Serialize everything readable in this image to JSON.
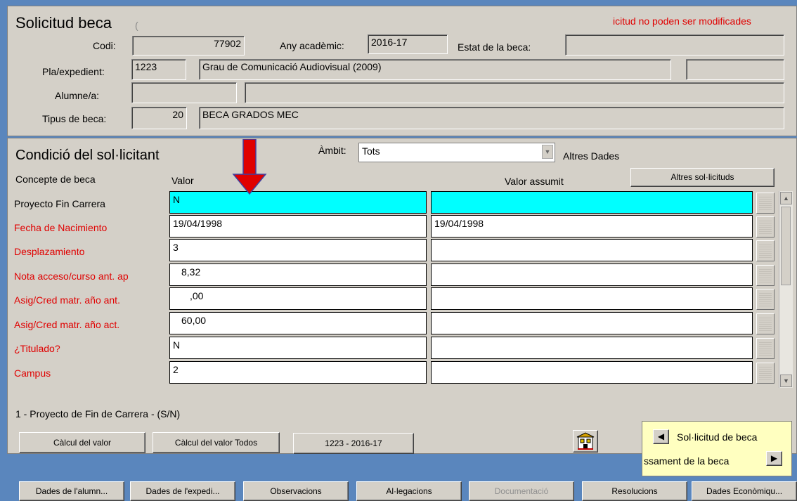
{
  "header": {
    "title": "Solicitud beca",
    "warning": "icitud no poden ser modificades",
    "codi_label": "Codi:",
    "codi_value": "77902",
    "any_label": "Any acadèmic:",
    "any_value": "2016-17",
    "estat_label": "Estat de la beca:",
    "pla_label": "Pla/expedient:",
    "pla_code": "1223",
    "pla_name": "Grau de Comunicació Audiovisual (2009)",
    "alumne_label": "Alumne/a:",
    "tipus_label": "Tipus de beca:",
    "tipus_code": "20",
    "tipus_name": "BECA GRADOS MEC"
  },
  "condicio": {
    "title": "Condició del sol·licitant",
    "ambit_label": "Àmbit:",
    "ambit_value": "Tots",
    "altres_dades": "Altres Dades",
    "col_concepte": "Concepte de beca",
    "col_valor": "Valor",
    "col_assumit": "Valor assumit",
    "altres_solicituds_button": "Altres sol·licituds",
    "rows": [
      {
        "concepte": "Proyecto Fin Carrera",
        "valor": "N",
        "assumit": ""
      },
      {
        "concepte": "Fecha de Nacimiento",
        "valor": "19/04/1998",
        "assumit": "19/04/1998"
      },
      {
        "concepte": "Desplazamiento",
        "valor": "3",
        "assumit": ""
      },
      {
        "concepte": "Nota acceso/curso ant. ap",
        "valor": "8,32",
        "assumit": ""
      },
      {
        "concepte": "Asig/Cred matr. año ant.",
        "valor": ",00",
        "assumit": ""
      },
      {
        "concepte": "Asig/Cred matr. año act.",
        "valor": "60,00",
        "assumit": ""
      },
      {
        "concepte": "¿Titulado?",
        "valor": "N",
        "assumit": ""
      },
      {
        "concepte": "Campus",
        "valor": "2",
        "assumit": ""
      }
    ],
    "hint": "1 - Proyecto de Fin de Carrera - (S/N)",
    "calc_button": "Càlcul del valor",
    "calc_all_button": "Càlcul del valor Todos",
    "plan_year_button": "1223 - 2016-17"
  },
  "nav_box": {
    "solicitud": "Sol·licitud de beca",
    "processament": "ssament de la beca"
  },
  "bottom_buttons": [
    {
      "label": "Dades de l'alumn...",
      "enabled": true
    },
    {
      "label": "Dades de l'expedi...",
      "enabled": true
    },
    {
      "label": "Observacions",
      "enabled": true
    },
    {
      "label": "Al·legacions",
      "enabled": true
    },
    {
      "label": "Documentació",
      "enabled": false
    },
    {
      "label": "Resolucions",
      "enabled": true
    },
    {
      "label": "Dades Econòmiqu...",
      "enabled": true
    }
  ],
  "colors": {
    "highlight": "#00ffff",
    "required_label": "#e00000",
    "background": "#5a86bd",
    "nav_box": "#ffffc0",
    "arrow": "#e00000"
  }
}
